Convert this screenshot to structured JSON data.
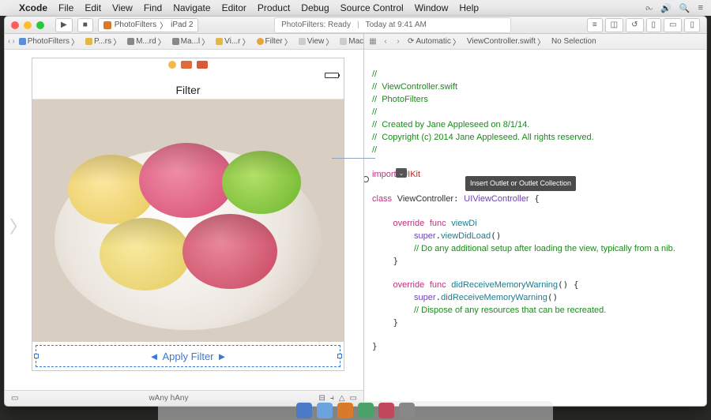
{
  "menubar": {
    "app": "Xcode",
    "items": [
      "File",
      "Edit",
      "View",
      "Find",
      "Navigate",
      "Editor",
      "Product",
      "Debug",
      "Source Control",
      "Window",
      "Help"
    ]
  },
  "toolbar": {
    "scheme_app": "PhotoFilters",
    "scheme_device": "iPad 2",
    "activity_title": "PhotoFilters: Ready",
    "activity_sub": "Today at 9:41 AM"
  },
  "left_jump": {
    "items": [
      "PhotoFilters",
      "P...rs",
      "M...rd",
      "Ma...l",
      "Vi...r",
      "Filter",
      "View",
      "Macarons.jpg"
    ]
  },
  "right_jump": {
    "mode": "Automatic",
    "file": "ViewController.swift",
    "sel": "No Selection"
  },
  "ib": {
    "title": "Filter",
    "button": "Apply Filter",
    "size": "wAny hAny"
  },
  "tooltip": "Insert Outlet or Outlet Collection",
  "code": {
    "c1": "//",
    "c2": "//  ViewController.swift",
    "c3": "//  PhotoFilters",
    "c4": "//",
    "c5": "//  Created by Jane Appleseed on 8/1/14.",
    "c6": "//  Copyright (c) 2014 Jane Appleseed. All rights reserved.",
    "c7": "//",
    "import_kw": "import",
    "import_mod": "UIKit",
    "class_kw": "class",
    "class_name": "ViewController",
    "super_name": "UIViewController",
    "override": "override",
    "func": "func",
    "viewDidLoad": "viewDidLoad",
    "viewDi": "viewDi",
    "superv": "super",
    "vdlCall": "viewDidLoad",
    "cmt_setup": "// Do any additional setup after loading the view, typically from a nib.",
    "didReceive": "didReceiveMemoryWarning",
    "drmCall": "didReceiveMemoryWarning",
    "cmt_dispose": "// Dispose of any resources that can be recreated."
  }
}
